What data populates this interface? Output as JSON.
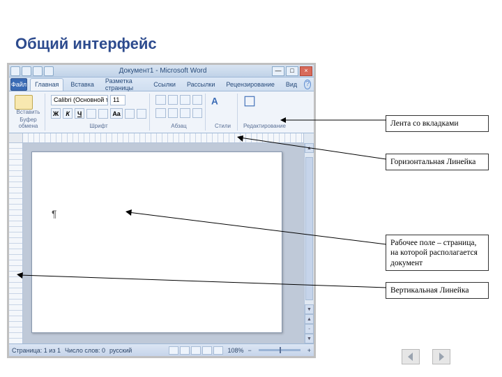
{
  "slide": {
    "title": "Общий интерфейс"
  },
  "window": {
    "title": "Документ1 - Microsoft Word",
    "office_button": "Файл",
    "tabs": [
      "Главная",
      "Вставка",
      "Разметка страницы",
      "Ссылки",
      "Рассылки",
      "Рецензирование",
      "Вид"
    ],
    "active_tab_index": 0,
    "help_symbol": "?"
  },
  "ribbon": {
    "clipboard": {
      "paste": "Вставить",
      "group_label": "Буфер обмена"
    },
    "font": {
      "font_name": "Calibri (Основной текст)",
      "font_size": "11",
      "buttons": {
        "bold": "Ж",
        "italic": "К",
        "underline": "Ч"
      },
      "group_label": "Шрифт"
    },
    "paragraph": {
      "group_label": "Абзац"
    },
    "styles": {
      "group_label": "Стили"
    },
    "editing": {
      "group_label": "Редактирование"
    }
  },
  "document": {
    "pilcrow": "¶"
  },
  "statusbar": {
    "page": "Страница: 1 из 1",
    "words": "Число слов: 0",
    "lang": "русский",
    "zoom": "108%",
    "zoom_minus": "−",
    "zoom_plus": "+"
  },
  "callouts": {
    "ribbon": "Лента со вкладками",
    "ruler_h": "Горизонтальная Линейка",
    "workarea": "Рабочее поле – страница, на которой располагается документ",
    "ruler_v": "Вертикальная Линейка"
  },
  "icons": {
    "min": "—",
    "max": "□",
    "close": "×",
    "up": "▲",
    "down": "▼",
    "pgup": "▲",
    "pgdn": "▼"
  }
}
